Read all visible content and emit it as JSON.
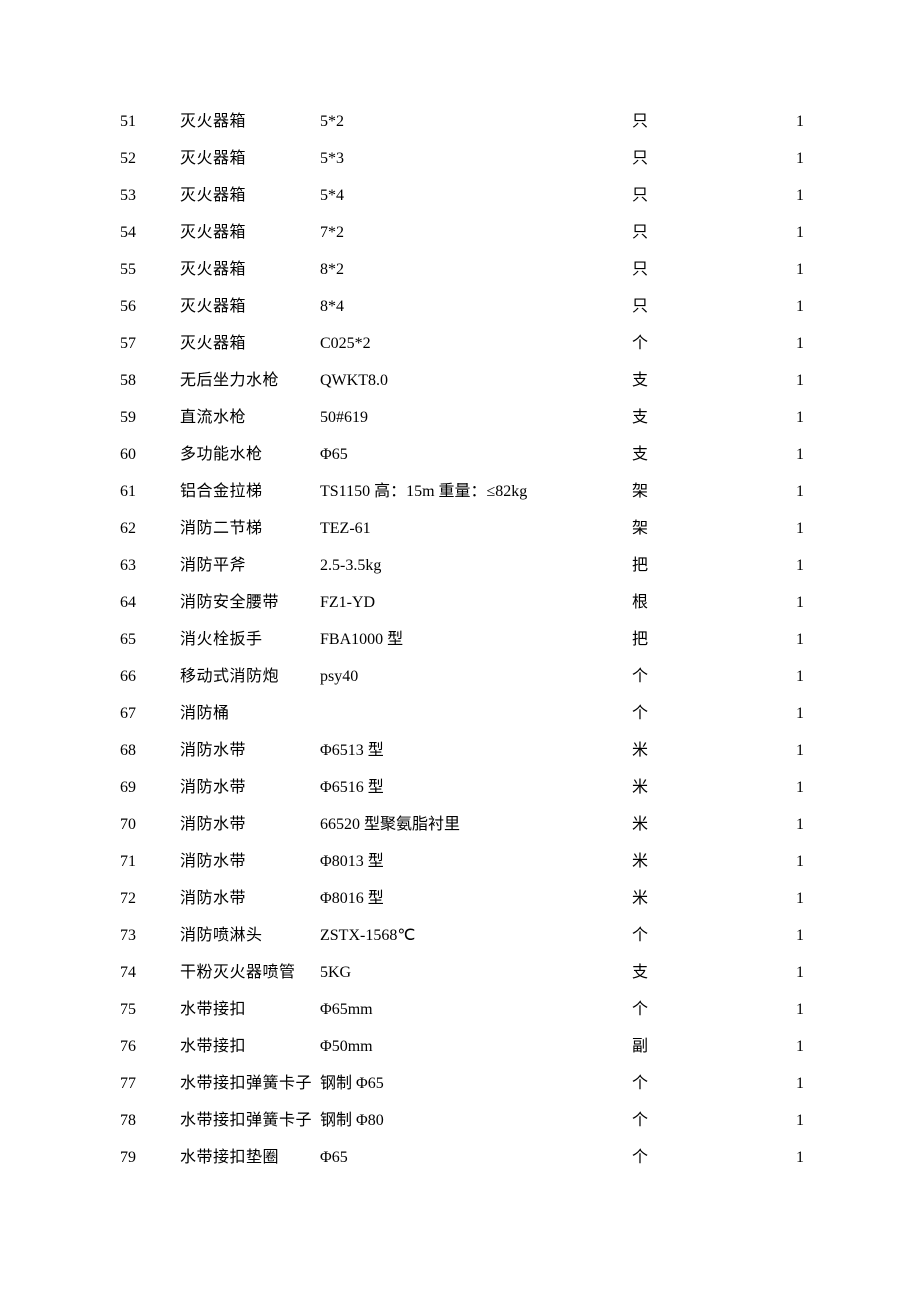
{
  "rows": [
    {
      "id": "51",
      "name": "灭火器箱",
      "spec": "5*2",
      "unit": "只",
      "qty": "1"
    },
    {
      "id": "52",
      "name": "灭火器箱",
      "spec": "5*3",
      "unit": "只",
      "qty": "1"
    },
    {
      "id": "53",
      "name": "灭火器箱",
      "spec": "5*4",
      "unit": "只",
      "qty": "1"
    },
    {
      "id": "54",
      "name": "灭火器箱",
      "spec": "7*2",
      "unit": "只",
      "qty": "1"
    },
    {
      "id": "55",
      "name": "灭火器箱",
      "spec": "8*2",
      "unit": "只",
      "qty": "1"
    },
    {
      "id": "56",
      "name": "灭火器箱",
      "spec": "8*4",
      "unit": "只",
      "qty": "1"
    },
    {
      "id": "57",
      "name": "灭火器箱",
      "spec": "C025*2",
      "unit": "个",
      "qty": "1"
    },
    {
      "id": "58",
      "name": "无后坐力水枪",
      "spec": "QWKT8.0",
      "unit": "支",
      "qty": "1"
    },
    {
      "id": "59",
      "name": "直流水枪",
      "spec": "50#619",
      "unit": "支",
      "qty": "1"
    },
    {
      "id": "60",
      "name": "多功能水枪",
      "spec": "Φ65",
      "unit": "支",
      "qty": "1"
    },
    {
      "id": "61",
      "name": "铝合金拉梯",
      "spec": "TS1150 高：15m 重量：≤82kg",
      "unit": "架",
      "qty": "1"
    },
    {
      "id": "62",
      "name": "消防二节梯",
      "spec": "TEZ-61",
      "unit": "架",
      "qty": "1"
    },
    {
      "id": "63",
      "name": "消防平斧",
      "spec": "2.5-3.5kg",
      "unit": "把",
      "qty": "1"
    },
    {
      "id": "64",
      "name": "消防安全腰带",
      "spec": "FZ1-YD",
      "unit": "根",
      "qty": "1"
    },
    {
      "id": "65",
      "name": "消火栓扳手",
      "spec": "FBA1000 型",
      "unit": "把",
      "qty": "1"
    },
    {
      "id": "66",
      "name": "移动式消防炮",
      "spec": "psy40",
      "unit": "个",
      "qty": "1"
    },
    {
      "id": "67",
      "name": "消防桶",
      "spec": "",
      "unit": "个",
      "qty": "1"
    },
    {
      "id": "68",
      "name": "消防水带",
      "spec": "Φ6513 型",
      "unit": "米",
      "qty": "1"
    },
    {
      "id": "69",
      "name": "消防水带",
      "spec": "Φ6516 型",
      "unit": "米",
      "qty": "1"
    },
    {
      "id": "70",
      "name": "消防水带",
      "spec": "66520 型聚氨脂衬里",
      "unit": "米",
      "qty": "1"
    },
    {
      "id": "71",
      "name": "消防水带",
      "spec": "Φ8013 型",
      "unit": "米",
      "qty": "1"
    },
    {
      "id": "72",
      "name": "消防水带",
      "spec": "Φ8016 型",
      "unit": "米",
      "qty": "1"
    },
    {
      "id": "73",
      "name": "消防喷淋头",
      "spec": "ZSTX-1568℃",
      "unit": "个",
      "qty": "1"
    },
    {
      "id": "74",
      "name": "干粉灭火器喷管",
      "spec": "5KG",
      "unit": "支",
      "qty": "1"
    },
    {
      "id": "75",
      "name": "水带接扣",
      "spec": "Φ65mm",
      "unit": "个",
      "qty": "1"
    },
    {
      "id": "76",
      "name": "水带接扣",
      "spec": "Φ50mm",
      "unit": "副",
      "qty": "1"
    },
    {
      "id": "77",
      "name": "水带接扣弹簧卡子",
      "spec": "钢制 Φ65",
      "unit": "个",
      "qty": "1"
    },
    {
      "id": "78",
      "name": "水带接扣弹簧卡子",
      "spec": "钢制 Φ80",
      "unit": "个",
      "qty": "1"
    },
    {
      "id": "79",
      "name": "水带接扣垫圈",
      "spec": "Φ65",
      "unit": "个",
      "qty": "1"
    }
  ]
}
